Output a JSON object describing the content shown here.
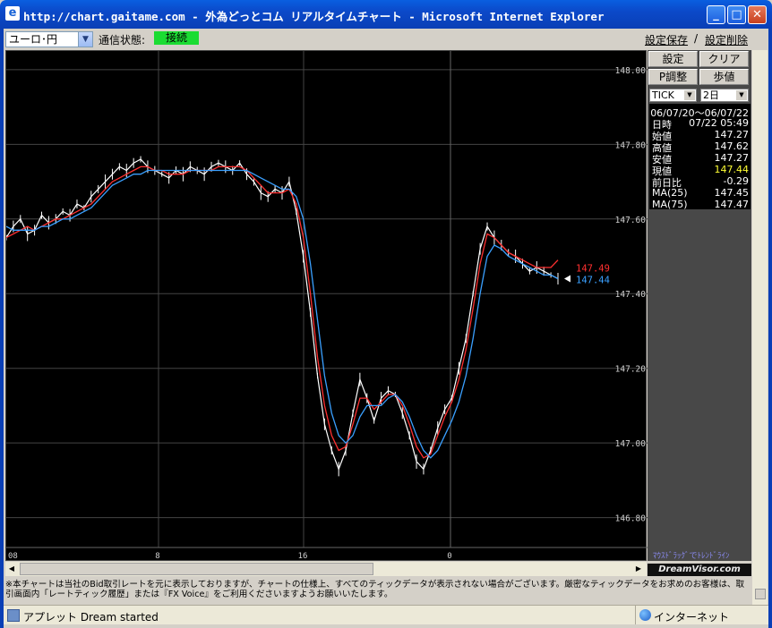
{
  "window": {
    "title": "http://chart.gaitame.com - 外為どっとコム リアルタイムチャート - Microsoft Internet Explorer",
    "icon": "ie-icon",
    "controls": [
      "minimize",
      "maximize",
      "close"
    ]
  },
  "toolbar": {
    "pair": "ユーロ･円",
    "status_label": "通信状態:",
    "status_value": "接続",
    "status_color": "#1bdc32",
    "save_link": "設定保存",
    "separator": "/",
    "delete_link": "設定削除"
  },
  "panel": {
    "btn_settings": "設定",
    "btn_clear": "クリア",
    "btn_p_adjust": "P調整",
    "btn_step": "歩値",
    "tick_select": "TICK",
    "days_select": "2日",
    "date_range": "06/07/20～06/07/22",
    "rows": [
      {
        "label": "日時",
        "value": "07/22 05:49",
        "color": "#ffffff"
      },
      {
        "label": "始値",
        "value": "147.27",
        "color": "#ffffff"
      },
      {
        "label": "高値",
        "value": "147.62",
        "color": "#ffffff"
      },
      {
        "label": "安値",
        "value": "147.27",
        "color": "#ffffff"
      },
      {
        "label": "現値",
        "value": "147.44",
        "color": "#ffff33"
      },
      {
        "label": "前日比",
        "value": "-0.29",
        "color": "#ffffff"
      },
      {
        "label": "MA(25)",
        "value": "147.45",
        "color": "#ffffff"
      },
      {
        "label": "MA(75)",
        "value": "147.47",
        "color": "#ffffff"
      }
    ],
    "mouse_hint": "ﾏｳｽﾄﾞﾗｯｸﾞでﾄﾚﾝﾄﾞﾗｲﾝ",
    "brand": "DreamVisor.com"
  },
  "chart_data": {
    "type": "line",
    "ylim": [
      146.72,
      148.05
    ],
    "y_ticks": [
      "148.00",
      "147.80",
      "147.60",
      "147.40",
      "147.20",
      "147.00",
      "146.80"
    ],
    "x_ticks": [
      "08",
      "8",
      "16",
      "0"
    ],
    "colors": {
      "price": "#ffffff",
      "ma25": "#ff3030",
      "ma75": "#3aa0ff"
    },
    "markers": {
      "ma25": "147.49",
      "ma75": "147.44"
    },
    "series": [
      {
        "key": "price",
        "values": [
          147.55,
          147.58,
          147.6,
          147.56,
          147.57,
          147.61,
          147.59,
          147.6,
          147.62,
          147.61,
          147.64,
          147.63,
          147.66,
          147.68,
          147.7,
          147.72,
          147.74,
          147.73,
          147.75,
          147.76,
          147.74,
          147.73,
          147.72,
          147.71,
          147.73,
          147.72,
          147.74,
          147.73,
          147.72,
          147.74,
          147.75,
          147.74,
          147.73,
          147.75,
          147.72,
          147.7,
          147.67,
          147.66,
          147.68,
          147.67,
          147.7,
          147.62,
          147.5,
          147.35,
          147.18,
          147.05,
          146.98,
          146.93,
          146.98,
          147.08,
          147.17,
          147.12,
          147.06,
          147.12,
          147.14,
          147.13,
          147.08,
          147.02,
          146.95,
          146.93,
          146.98,
          147.04,
          147.09,
          147.12,
          147.2,
          147.28,
          147.4,
          147.52,
          147.58,
          147.55,
          147.53,
          147.51,
          147.5,
          147.48,
          147.46,
          147.47,
          147.46,
          147.45,
          147.44
        ]
      },
      {
        "key": "ma25",
        "values": [
          147.55,
          147.56,
          147.57,
          147.58,
          147.57,
          147.58,
          147.59,
          147.6,
          147.6,
          147.61,
          147.62,
          147.63,
          147.64,
          147.66,
          147.68,
          147.7,
          147.71,
          147.72,
          147.73,
          147.74,
          147.74,
          147.73,
          147.73,
          147.72,
          147.72,
          147.72,
          147.73,
          147.73,
          147.73,
          147.73,
          147.74,
          147.74,
          147.74,
          147.74,
          147.73,
          147.71,
          147.69,
          147.67,
          147.67,
          147.67,
          147.68,
          147.64,
          147.55,
          147.4,
          147.23,
          147.1,
          147.02,
          146.98,
          146.99,
          147.05,
          147.12,
          147.12,
          147.09,
          147.11,
          147.13,
          147.13,
          147.1,
          147.05,
          146.99,
          146.96,
          146.97,
          147.02,
          147.07,
          147.11,
          147.17,
          147.25,
          147.36,
          147.48,
          147.56,
          147.55,
          147.53,
          147.51,
          147.5,
          147.49,
          147.48,
          147.47,
          147.47,
          147.47,
          147.49
        ]
      },
      {
        "key": "ma75",
        "values": [
          147.58,
          147.57,
          147.57,
          147.57,
          147.57,
          147.58,
          147.58,
          147.59,
          147.6,
          147.6,
          147.61,
          147.62,
          147.63,
          147.65,
          147.67,
          147.69,
          147.7,
          147.71,
          147.72,
          147.72,
          147.73,
          147.73,
          147.73,
          147.73,
          147.73,
          147.73,
          147.73,
          147.73,
          147.73,
          147.73,
          147.73,
          147.73,
          147.73,
          147.73,
          147.73,
          147.72,
          147.71,
          147.7,
          147.69,
          147.68,
          147.68,
          147.66,
          147.6,
          147.48,
          147.33,
          147.18,
          147.08,
          147.02,
          147.0,
          147.02,
          147.07,
          147.1,
          147.1,
          147.1,
          147.12,
          147.13,
          147.11,
          147.07,
          147.02,
          146.98,
          146.96,
          146.98,
          147.02,
          147.06,
          147.11,
          147.18,
          147.28,
          147.4,
          147.5,
          147.53,
          147.52,
          147.5,
          147.49,
          147.48,
          147.47,
          147.46,
          147.45,
          147.45,
          147.44
        ]
      }
    ]
  },
  "scrollbar": {
    "left_arrow": "◀",
    "right_arrow": "▶"
  },
  "notice": "※本チャートは当社のBid取引レートを元に表示しておりますが、チャートの仕様上、すべてのティックデータが表示されない場合がございます。厳密なティックデータをお求めのお客様は、取引画面内「レートティック履歴」または『FX Voice』をご利用くださいますようお願いいたします。",
  "statusbar": {
    "text": "アプレット Dream started",
    "zone": "インターネット"
  }
}
